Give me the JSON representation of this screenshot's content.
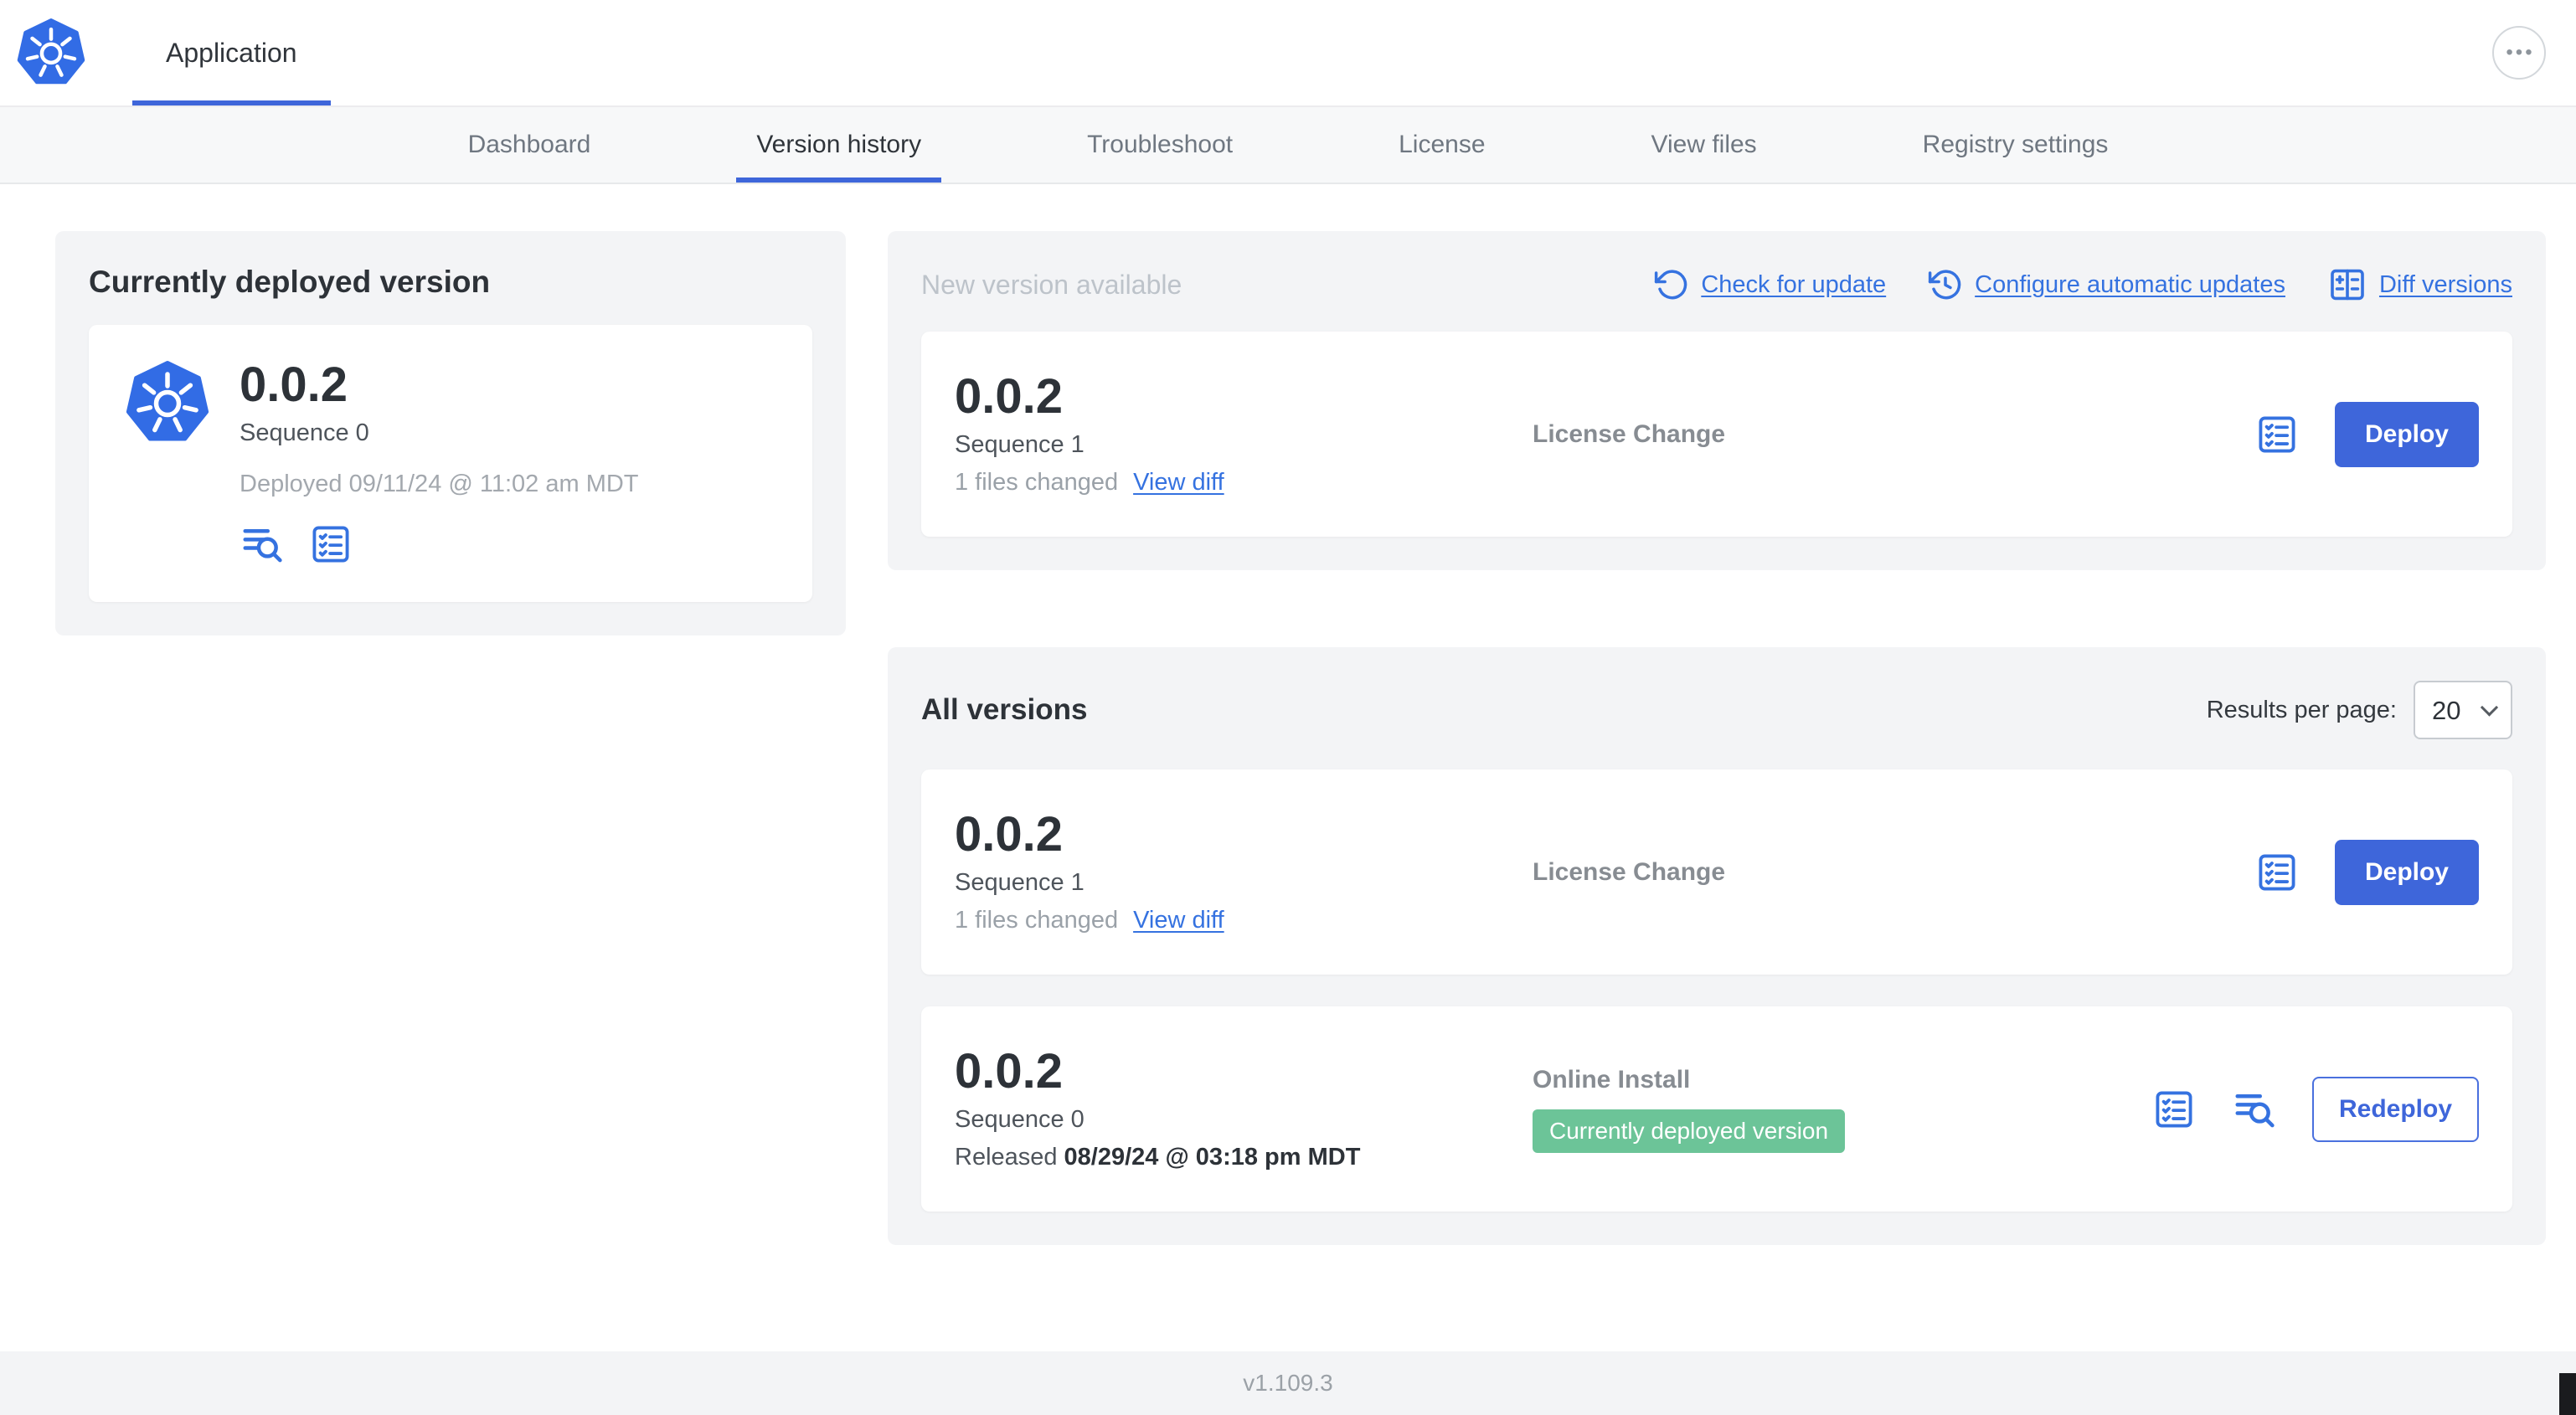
{
  "colors": {
    "primary_blue": "#3E66DA",
    "link_blue": "#3572E0",
    "badge_green": "#6CC498",
    "kubernetes_blue": "#326CE5",
    "card_gray": "#F3F4F6"
  },
  "icons": {
    "more_menu": "•••",
    "kubernetes_logo": "kubernetes-helm-wheel",
    "check_update_icon": "rotate-ccw-arrow",
    "auto_update_icon": "clock-rotate-arrow",
    "diff_icon": "split-diff-panes",
    "release_notes_icon": "checklist-square",
    "logs_icon": "lines-with-magnifier"
  },
  "header": {
    "app_tab": "Application"
  },
  "nav": {
    "tabs": [
      {
        "label": "Dashboard"
      },
      {
        "label": "Version history"
      },
      {
        "label": "Troubleshoot"
      },
      {
        "label": "License"
      },
      {
        "label": "View files"
      },
      {
        "label": "Registry settings"
      }
    ]
  },
  "deployed": {
    "title": "Currently deployed version",
    "version": "0.0.2",
    "sequence": "Sequence 0",
    "deployed_at": "Deployed 09/11/24 @ 11:02 am MDT"
  },
  "new_version": {
    "title": "New version available",
    "check_for_update": "Check for update",
    "configure_auto_updates": "Configure automatic updates",
    "diff_versions": "Diff versions",
    "row": {
      "version": "0.0.2",
      "sequence": "Sequence 1",
      "files_changed": "1 files changed",
      "view_diff": "View diff",
      "notes": "License Change",
      "action": "Deploy"
    }
  },
  "all_versions": {
    "title": "All versions",
    "results_per_page_label": "Results per page:",
    "results_per_page_value": "20",
    "rows": [
      {
        "version": "0.0.2",
        "sequence": "Sequence 1",
        "files_changed": "1 files changed",
        "view_diff": "View diff",
        "notes": "License Change",
        "action": "Deploy"
      },
      {
        "version": "0.0.2",
        "sequence": "Sequence 0",
        "released_label": "Released",
        "released_date": "08/29/24 @ 03:18 pm MDT",
        "notes": "Online Install",
        "badge": "Currently deployed version",
        "action": "Redeploy"
      }
    ]
  },
  "footer": {
    "app_version": "v1.109.3"
  }
}
